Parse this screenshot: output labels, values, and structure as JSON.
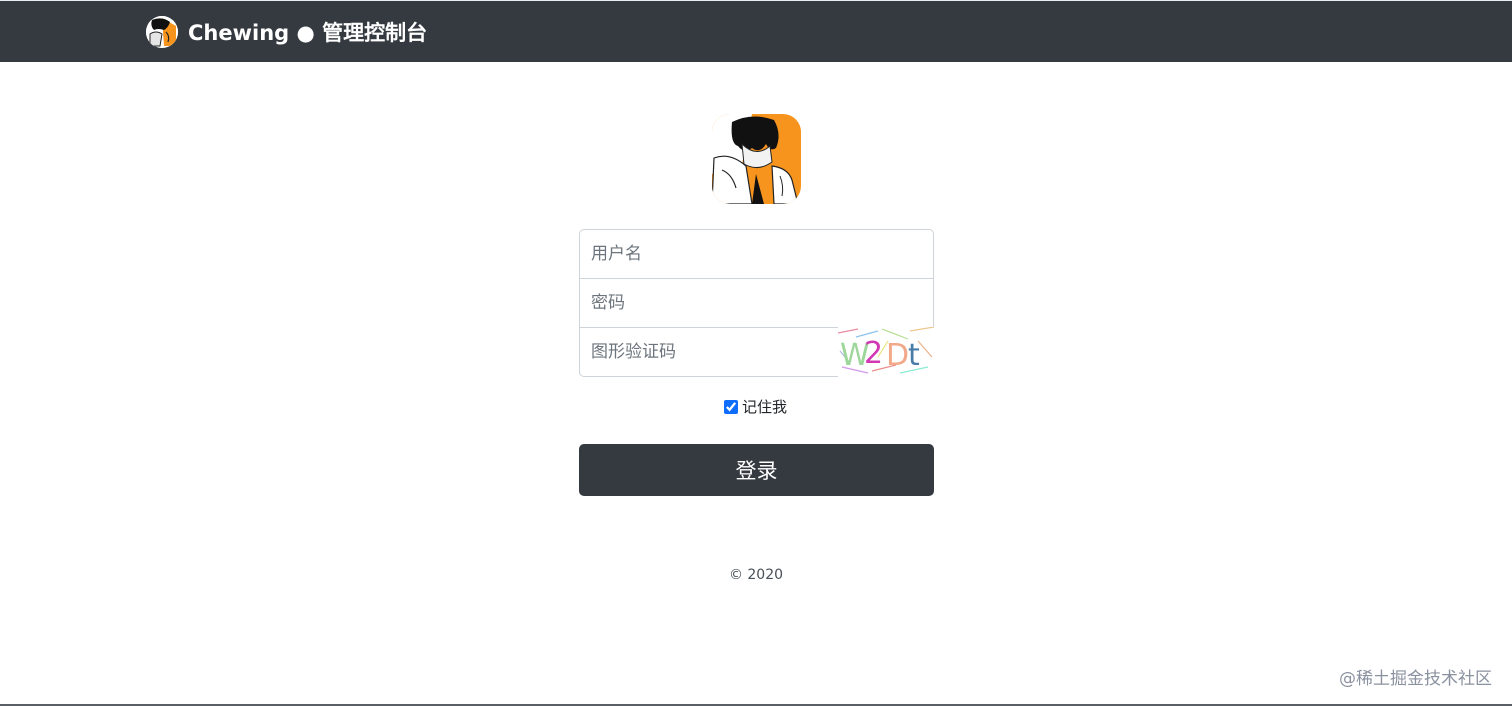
{
  "navbar": {
    "brand_text": "Chewing ● 管理控制台",
    "logo_icon": "avatar-logo-icon",
    "background": "#343a40"
  },
  "login": {
    "avatar_icon": "anime-avatar-icon",
    "username_placeholder": "用户名",
    "password_placeholder": "密码",
    "captcha_placeholder": "图形验证码",
    "captcha_text": "W2Dt",
    "remember_label": "记住我",
    "remember_checked": true,
    "submit_label": "登录"
  },
  "footer": {
    "copyright": "© 2020"
  },
  "watermark": "@稀土掘金技术社区",
  "colors": {
    "dark": "#343a40",
    "accent": "#f7941d",
    "checkbox": "#0d6efd"
  }
}
